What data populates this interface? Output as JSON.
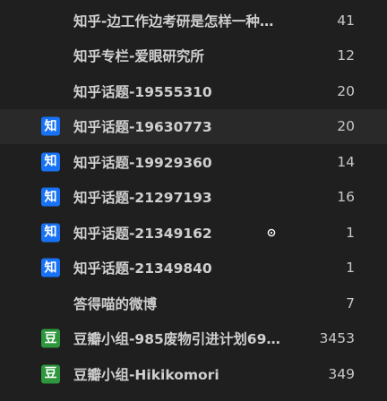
{
  "feeds": [
    {
      "title": "知乎-边工作边考研是怎样一种…",
      "count": "41",
      "icon": "",
      "icon_label": ""
    },
    {
      "title": "知乎专栏-爱眼研究所",
      "count": "12",
      "icon": "",
      "icon_label": ""
    },
    {
      "title": "知乎话题-19555310",
      "count": "20",
      "icon": "",
      "icon_label": ""
    },
    {
      "title": "知乎话题-19630773",
      "count": "20",
      "icon": "zhihu-icon",
      "icon_label": "知"
    },
    {
      "title": "知乎话题-19929360",
      "count": "14",
      "icon": "zhihu-icon",
      "icon_label": "知"
    },
    {
      "title": "知乎话题-21297193",
      "count": "16",
      "icon": "zhihu-icon",
      "icon_label": "知"
    },
    {
      "title": "知乎话题-21349162",
      "count": "1",
      "icon": "zhihu-icon",
      "icon_label": "知"
    },
    {
      "title": "知乎话题-21349840",
      "count": "1",
      "icon": "zhihu-icon",
      "icon_label": "知"
    },
    {
      "title": "答得喵的微博",
      "count": "7",
      "icon": "",
      "icon_label": ""
    },
    {
      "title": "豆瓣小组-985废物引进计划69…",
      "count": "3453",
      "icon": "douban-icon",
      "icon_label": "豆"
    },
    {
      "title": "豆瓣小组-Hikikomori",
      "count": "349",
      "icon": "douban-icon",
      "icon_label": "豆"
    }
  ],
  "colors": {
    "background": "#1f1f1f",
    "hover_row": "#292929",
    "zhihu_blue": "#1772f6",
    "douban_green": "#2e963d",
    "text": "#cfcfcf"
  }
}
